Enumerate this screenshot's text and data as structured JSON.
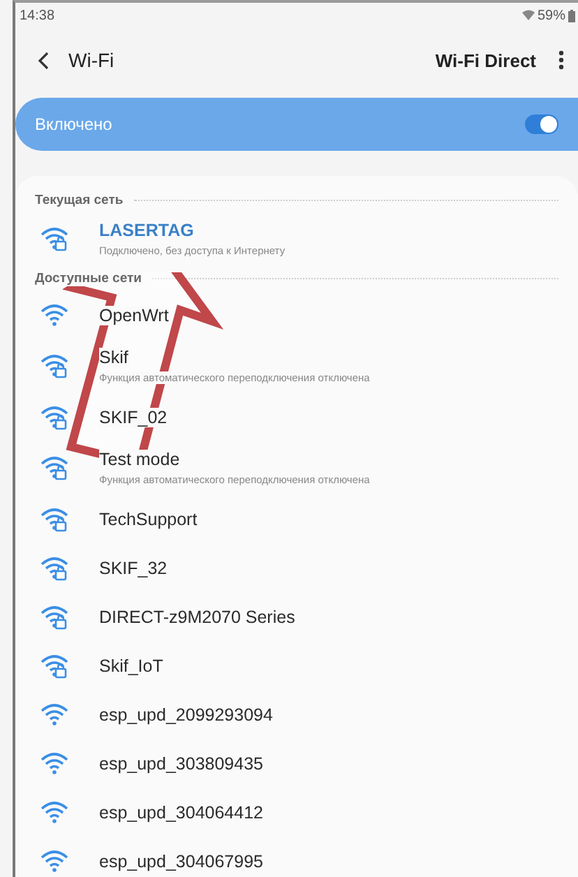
{
  "status_bar": {
    "time": "14:38",
    "battery": "59%"
  },
  "header": {
    "title": "Wi-Fi",
    "action": "Wi-Fi Direct"
  },
  "master_switch": {
    "label": "Включено",
    "on": true
  },
  "sections": [
    {
      "title": "Текущая сеть",
      "networks": [
        {
          "name": "LASERTAG",
          "detail": "Подключено, без доступа к Интернету",
          "secured": true,
          "connected": true
        }
      ]
    },
    {
      "title": "Доступные сети",
      "networks": [
        {
          "name": "OpenWrt",
          "secured": false,
          "connected": false
        },
        {
          "name": "Skif",
          "detail": "Функция автоматического переподключения отключена",
          "secured": true,
          "connected": false
        },
        {
          "name": "SKIF_02",
          "secured": true,
          "connected": false
        },
        {
          "name": "Test mode",
          "detail": "Функция автоматического переподключения отключена",
          "secured": true,
          "connected": false
        },
        {
          "name": "TechSupport",
          "secured": true,
          "connected": false
        },
        {
          "name": "SKIF_32",
          "secured": true,
          "connected": false
        },
        {
          "name": "DIRECT-z9M2070 Series",
          "secured": true,
          "connected": false
        },
        {
          "name": "Skif_IoT",
          "secured": true,
          "connected": false
        },
        {
          "name": "esp_upd_2099293094",
          "secured": false,
          "connected": false
        },
        {
          "name": "esp_upd_303809435",
          "secured": false,
          "connected": false
        },
        {
          "name": "esp_upd_304064412",
          "secured": false,
          "connected": false
        },
        {
          "name": "esp_upd_304067995",
          "secured": false,
          "connected": false
        }
      ]
    }
  ]
}
